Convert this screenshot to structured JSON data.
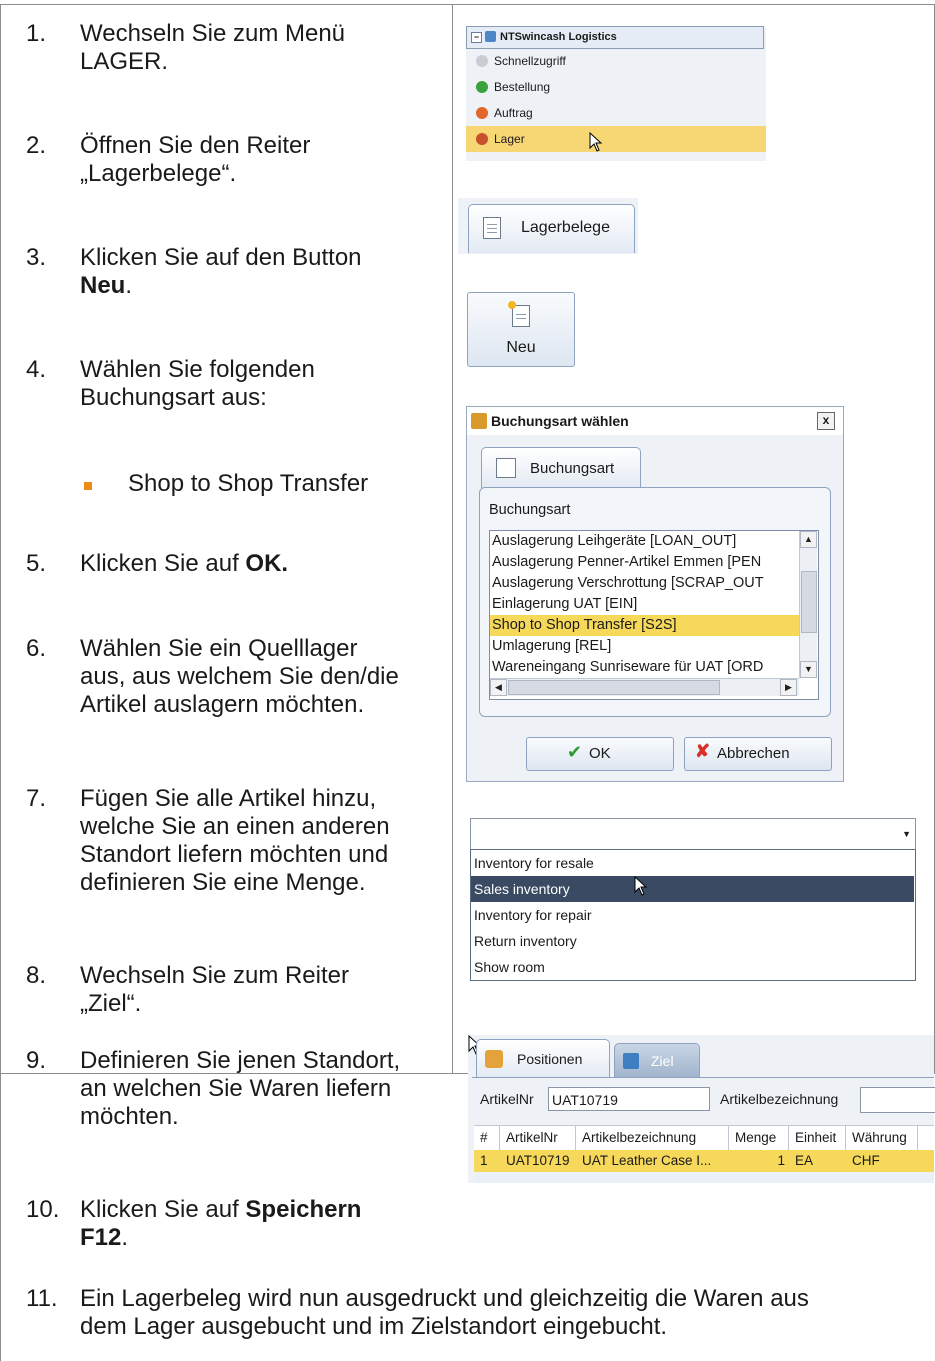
{
  "steps": [
    {
      "num": "1.",
      "line1": "Wechseln Sie zum Menü",
      "line2": "LAGER."
    },
    {
      "num": "2.",
      "line1": "Öffnen Sie den Reiter",
      "line2": "„Lagerbelege“."
    },
    {
      "num": "3.",
      "line1": "Klicken Sie auf den Button",
      "bold": "Neu",
      "after": "."
    },
    {
      "num": "4.",
      "line1": "Wählen Sie folgenden",
      "line2": "Buchungsart aus:"
    },
    {
      "num": "5.",
      "pre": "Klicken Sie auf ",
      "bold": "OK."
    },
    {
      "num": "6.",
      "line1": "Wählen Sie ein Quelllager",
      "line2": "aus, aus welchem Sie den/die",
      "line3": "Artikel auslagern möchten."
    },
    {
      "num": "7.",
      "line1": "Fügen Sie alle Artikel hinzu,",
      "line2": "welche Sie an einen anderen",
      "line3": "Standort liefern möchten und",
      "line4": "definieren Sie eine Menge."
    },
    {
      "num": "8.",
      "line1": "Wechseln Sie zum Reiter",
      "line2": "„Ziel“."
    },
    {
      "num": "9.",
      "line1": "Definieren Sie jenen Standort,",
      "line2": "an welchen Sie Waren liefern",
      "line3": "möchten."
    },
    {
      "num": "10.",
      "pre": "Klicken Sie auf ",
      "bold1": "Speichern",
      "bold2": "F12",
      "after": "."
    },
    {
      "num": "11.",
      "line1": "Ein Lagerbeleg wird nun ausgedruckt und gleichzeitig die Waren aus",
      "line2": "dem Lager ausgebucht und im Zielstandort eingebucht."
    }
  ],
  "bullet_text": "Shop to Shop Transfer",
  "tree": {
    "root": "NTSwincash Logistics",
    "items": [
      "Schnellzugriff",
      "Bestellung",
      "Auftrag",
      "Lager"
    ]
  },
  "tab_lagerbelege": "Lagerbelege",
  "btn_neu": "Neu",
  "dialog": {
    "title": "Buchungsart wählen",
    "close": "x",
    "tab": "Buchungsart",
    "label": "Buchungsart",
    "items": [
      "Auslagerung Leihgeräte [LOAN_OUT]",
      "Auslagerung Penner-Artikel Emmen [PEN",
      "Auslagerung Verschrottung [SCRAP_OUT",
      "Einlagerung UAT [EIN]",
      "Shop to Shop Transfer [S2S]",
      "Umlagerung [REL]",
      "Wareneingang Sunriseware für UAT [ORD"
    ],
    "ok": "OK",
    "cancel": "Abbrechen"
  },
  "dropdown": {
    "items": [
      "Inventory for resale",
      "Sales inventory",
      "Inventory for repair",
      "Return inventory",
      "Show room"
    ]
  },
  "grid": {
    "tab_positionen": "Positionen",
    "tab_ziel": "Ziel",
    "artikelnr_label": "ArtikelNr",
    "artikelnr_value": "UAT10719",
    "artikelbez_label": "Artikelbezeichnung",
    "headers": [
      "#",
      "ArtikelNr",
      "Artikelbezeichnung",
      "Menge",
      "Einheit",
      "Währung"
    ],
    "row": [
      "1",
      "UAT10719",
      "UAT Leather Case I...",
      "1",
      "EA",
      "CHF"
    ]
  },
  "colors": {
    "accent_bullet": "#ef8a17",
    "selection": "#f6d85a",
    "dropdown_selection": "#3a4a63"
  }
}
